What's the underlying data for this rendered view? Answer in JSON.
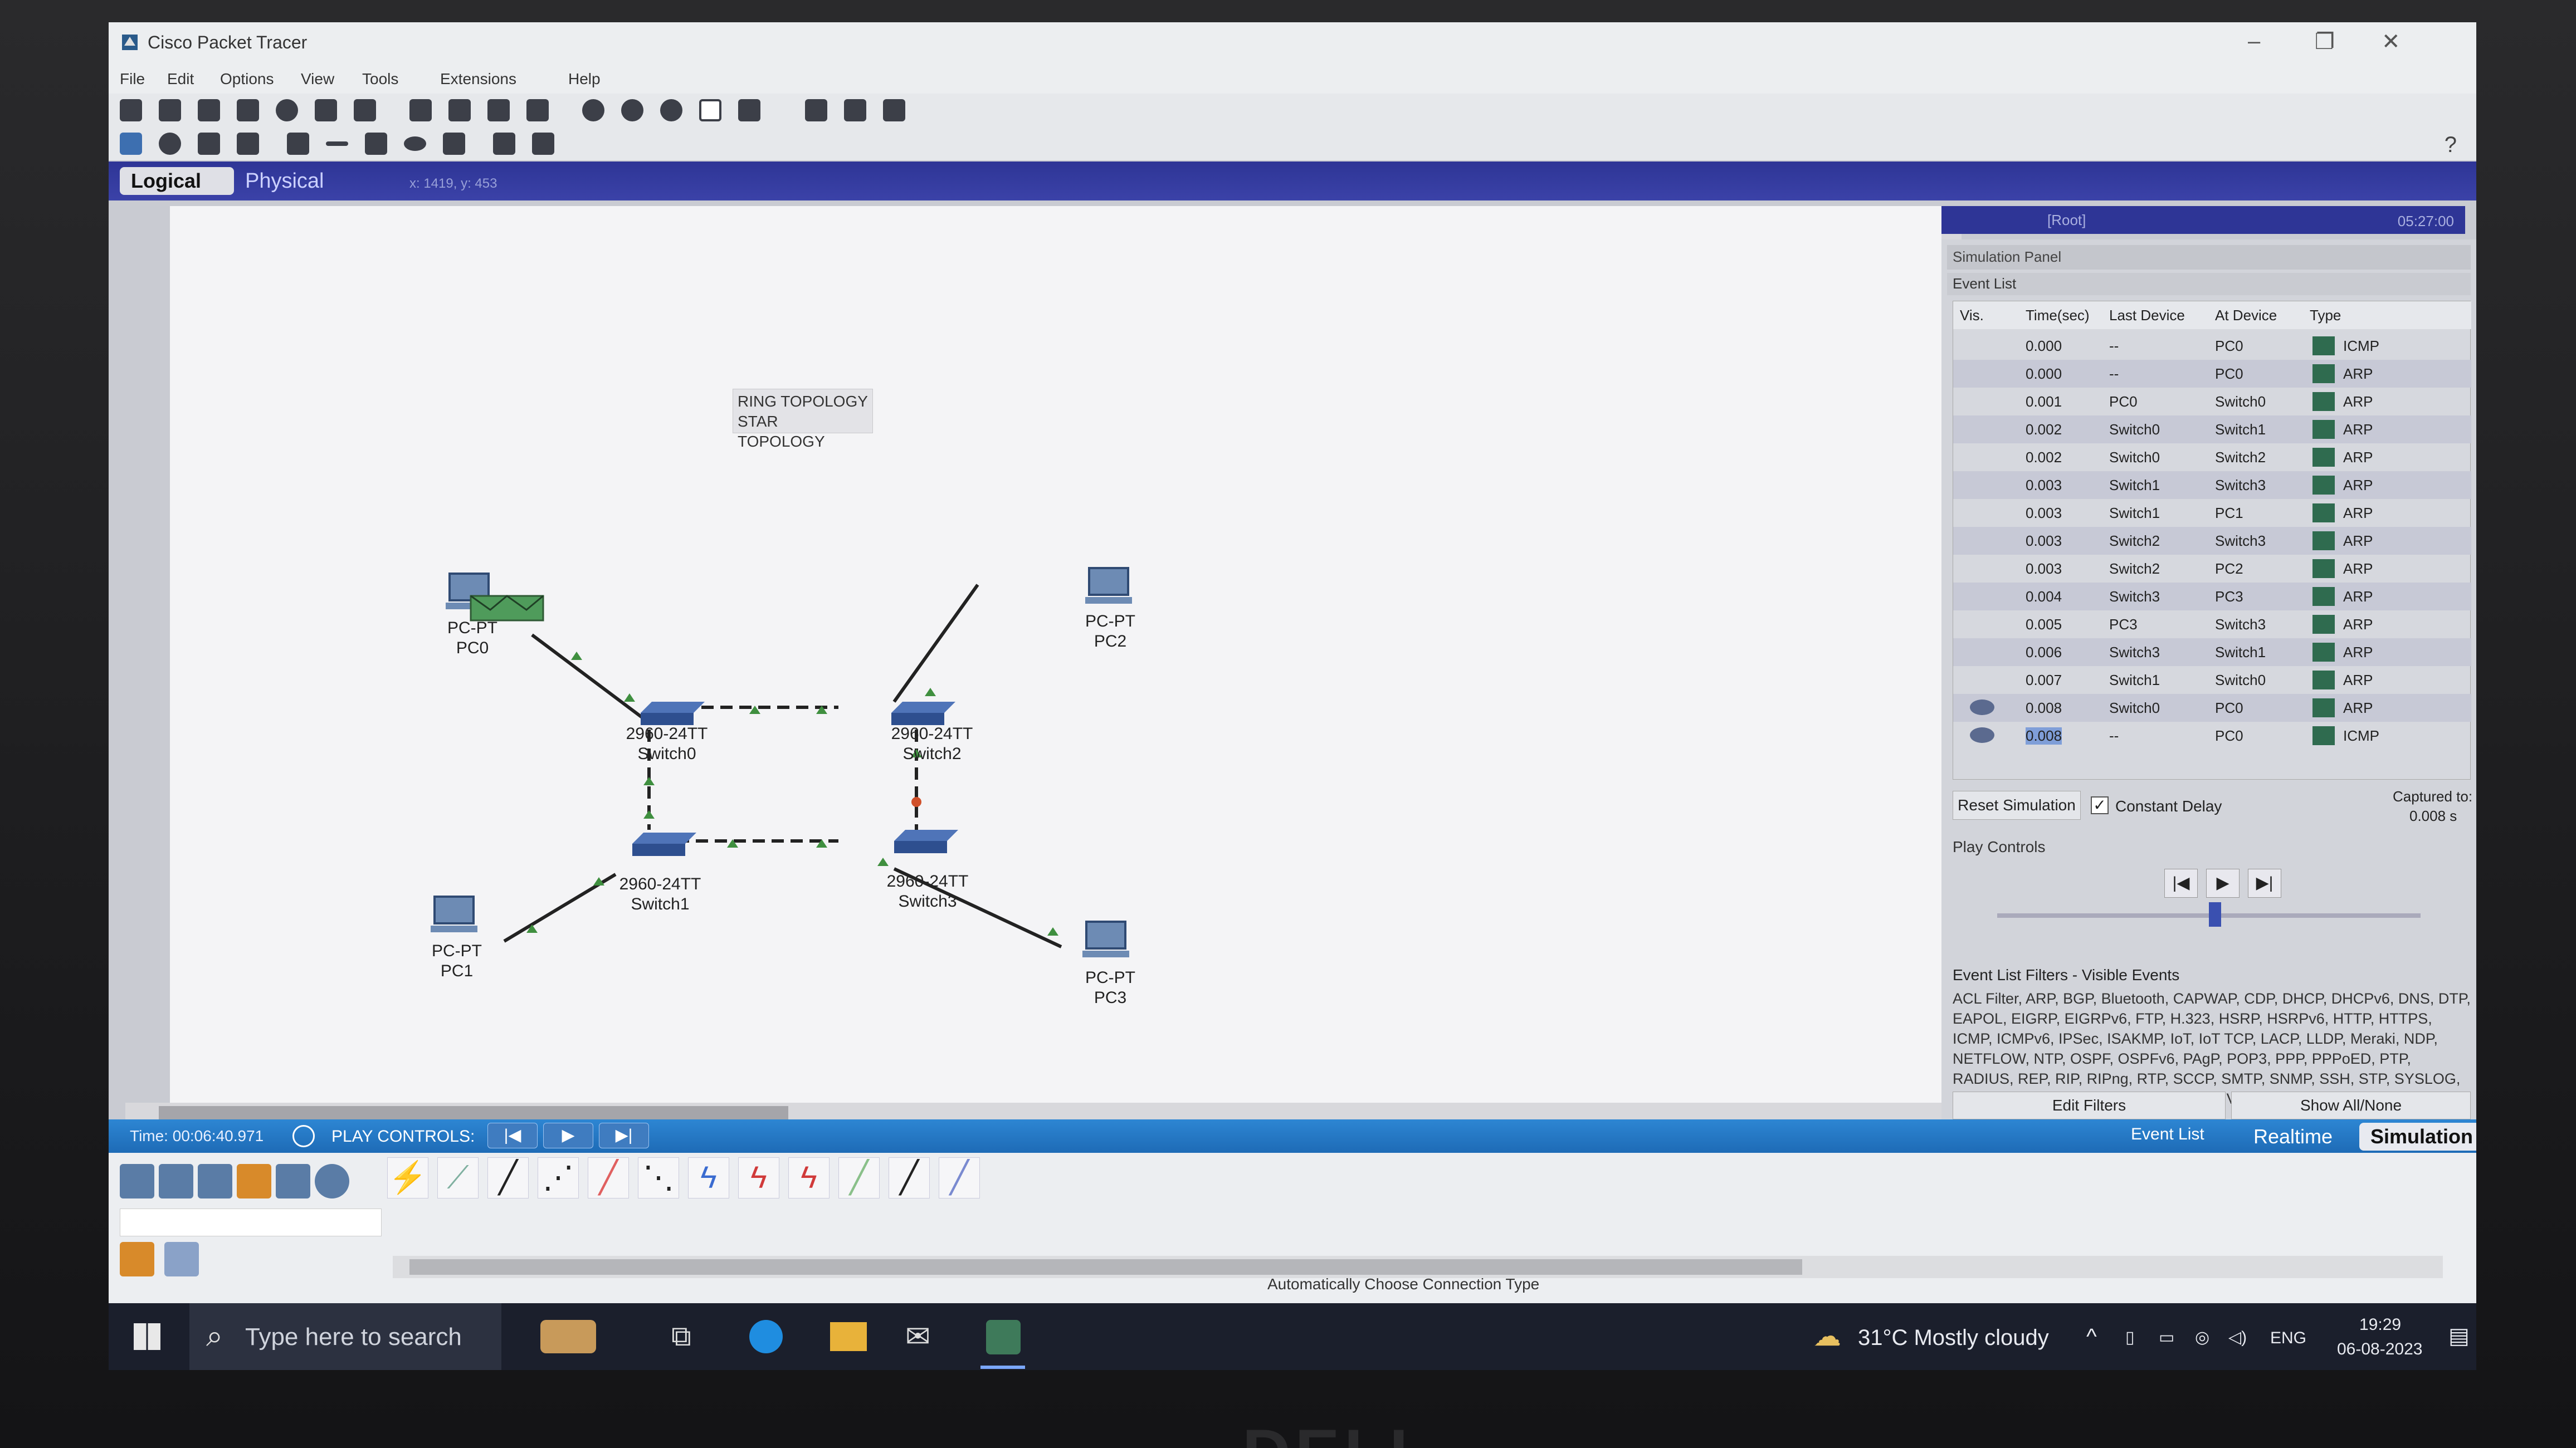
{
  "window": {
    "title": "Cisco Packet Tracer"
  },
  "menu": [
    "File",
    "Edit",
    "Options",
    "View",
    "Tools",
    "Extensions",
    "Help"
  ],
  "modebar": {
    "logical": "Logical",
    "physical": "Physical",
    "coord": "x: 1419, y: 453"
  },
  "subbar": {
    "root": "[Root]",
    "clock": "05:27:00"
  },
  "note": {
    "line1": "RING TOPOLOGY",
    "line2": "STAR TOPOLOGY"
  },
  "devices": [
    {
      "id": "pc0",
      "model": "PC-PT",
      "name": "PC0"
    },
    {
      "id": "pc1",
      "model": "PC-PT",
      "name": "PC1"
    },
    {
      "id": "pc2",
      "model": "PC-PT",
      "name": "PC2"
    },
    {
      "id": "pc3",
      "model": "PC-PT",
      "name": "PC3"
    },
    {
      "id": "sw0",
      "model": "2960-24TT",
      "name": "Switch0"
    },
    {
      "id": "sw1",
      "model": "2960-24TT",
      "name": "Switch1"
    },
    {
      "id": "sw2",
      "model": "2960-24TT",
      "name": "Switch2"
    },
    {
      "id": "sw3",
      "model": "2960-24TT",
      "name": "Switch3"
    }
  ],
  "sim": {
    "panel_title": "Simulation Panel",
    "event_list_title": "Event List",
    "columns": [
      "Vis.",
      "Time(sec)",
      "Last Device",
      "At Device",
      "Type"
    ],
    "events": [
      {
        "time": "0.000",
        "last": "--",
        "at": "PC0",
        "type": "ICMP"
      },
      {
        "time": "0.000",
        "last": "--",
        "at": "PC0",
        "type": "ARP"
      },
      {
        "time": "0.001",
        "last": "PC0",
        "at": "Switch0",
        "type": "ARP"
      },
      {
        "time": "0.002",
        "last": "Switch0",
        "at": "Switch1",
        "type": "ARP"
      },
      {
        "time": "0.002",
        "last": "Switch0",
        "at": "Switch2",
        "type": "ARP"
      },
      {
        "time": "0.003",
        "last": "Switch1",
        "at": "Switch3",
        "type": "ARP"
      },
      {
        "time": "0.003",
        "last": "Switch1",
        "at": "PC1",
        "type": "ARP"
      },
      {
        "time": "0.003",
        "last": "Switch2",
        "at": "Switch3",
        "type": "ARP"
      },
      {
        "time": "0.003",
        "last": "Switch2",
        "at": "PC2",
        "type": "ARP"
      },
      {
        "time": "0.004",
        "last": "Switch3",
        "at": "PC3",
        "type": "ARP"
      },
      {
        "time": "0.005",
        "last": "PC3",
        "at": "Switch3",
        "type": "ARP"
      },
      {
        "time": "0.006",
        "last": "Switch3",
        "at": "Switch1",
        "type": "ARP"
      },
      {
        "time": "0.007",
        "last": "Switch1",
        "at": "Switch0",
        "type": "ARP"
      },
      {
        "time": "0.008",
        "last": "Switch0",
        "at": "PC0",
        "type": "ARP"
      },
      {
        "time": "0.008",
        "last": "--",
        "at": "PC0",
        "type": "ICMP"
      }
    ],
    "reset_label": "Reset Simulation",
    "constant_delay_label": "Constant Delay",
    "captured_label": "Captured to:",
    "captured_value": "0.008 s",
    "play_controls_label": "Play Controls",
    "filters_title": "Event List Filters - Visible Events",
    "filters_text": "ACL Filter, ARP, BGP, Bluetooth, CAPWAP, CDP, DHCP, DHCPv6, DNS, DTP, EAPOL, EIGRP, EIGRPv6, FTP, H.323, HSRP, HSRPv6, HTTP, HTTPS, ICMP, ICMPv6, IPSec, ISAKMP, IoT, IoT TCP, LACP, LLDP, Meraki, NDP, NETFLOW, NTP, OSPF, OSPFv6, PAgP, POP3, PPP, PPPoED, PTP, RADIUS, REP, RIP, RIPng, RTP, SCCP, SMTP, SNMP, SSH, STP, SYSLOG, TACACS, TCP, TFTP, Telnet, UDP, USB, VTP",
    "edit_filters": "Edit Filters",
    "show_all": "Show All/None"
  },
  "status": {
    "time": "Time: 00:06:40.971",
    "play_controls": "PLAY CONTROLS:",
    "event_list": "Event List",
    "realtime": "Realtime",
    "simulation": "Simulation"
  },
  "autoconn": "Automatically Choose Connection Type",
  "taskbar": {
    "search_placeholder": "Type here to search",
    "weather": "31°C  Mostly cloudy",
    "lang": "ENG",
    "time": "19:29",
    "date": "06-08-2023"
  },
  "brand": "DELL"
}
